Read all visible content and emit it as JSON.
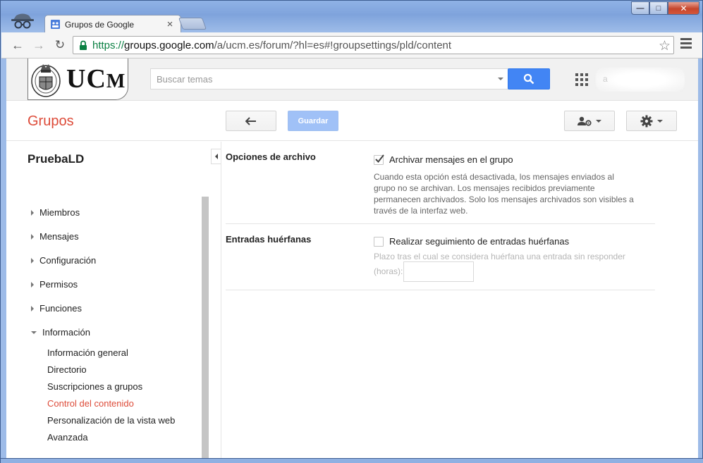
{
  "browser": {
    "tab_title": "Grupos de Google",
    "tab_close": "×",
    "url_scheme": "https://",
    "url_host": "groups.google.com",
    "url_path": "/a/ucm.es/forum/?hl=es#!groupsettings/pld/content",
    "star": "☆",
    "back": "←",
    "forward": "→",
    "reload": "↻",
    "win_min": "—",
    "win_max": "□",
    "win_close": "✕"
  },
  "header": {
    "logo_text_big": "UC",
    "logo_text_small": "M",
    "search_placeholder": "Buscar temas",
    "account_name": "a"
  },
  "actionbar": {
    "product": "Grupos",
    "save_label": "Guardar"
  },
  "sidebar": {
    "group_name": "PruebaLD",
    "items": [
      {
        "label": "Miembros"
      },
      {
        "label": "Mensajes"
      },
      {
        "label": "Configuración"
      },
      {
        "label": "Permisos"
      },
      {
        "label": "Funciones"
      },
      {
        "label": "Información"
      }
    ],
    "subitems": [
      {
        "label": "Información general"
      },
      {
        "label": "Directorio"
      },
      {
        "label": "Suscripciones a grupos"
      },
      {
        "label": "Control del contenido"
      },
      {
        "label": "Personalización de la vista web"
      },
      {
        "label": "Avanzada"
      }
    ]
  },
  "content": {
    "archive": {
      "label": "Opciones de archivo",
      "checkbox_label": "Archivar mensajes en el grupo",
      "checked": true,
      "help_line1": "Cuando esta opción está desactivada, los mensajes enviados al",
      "help_line2": "grupo no se archivan. Los mensajes recibidos previamente",
      "help_line3": "permanecen archivados. Solo los mensajes archivados son visibles a",
      "help_line4": "través de la interfaz web."
    },
    "orphan": {
      "label": "Entradas huérfanas",
      "checkbox_label": "Realizar seguimiento de entradas huérfanas",
      "checked": false,
      "help_line1": "Plazo tras el cual se considera huérfana una entrada sin responder",
      "hours_label": "(horas):",
      "hours_value": ""
    }
  },
  "colors": {
    "brand_red": "#dd4b39",
    "search_blue": "#4285f4",
    "save_disabled": "#a0c1f7"
  }
}
